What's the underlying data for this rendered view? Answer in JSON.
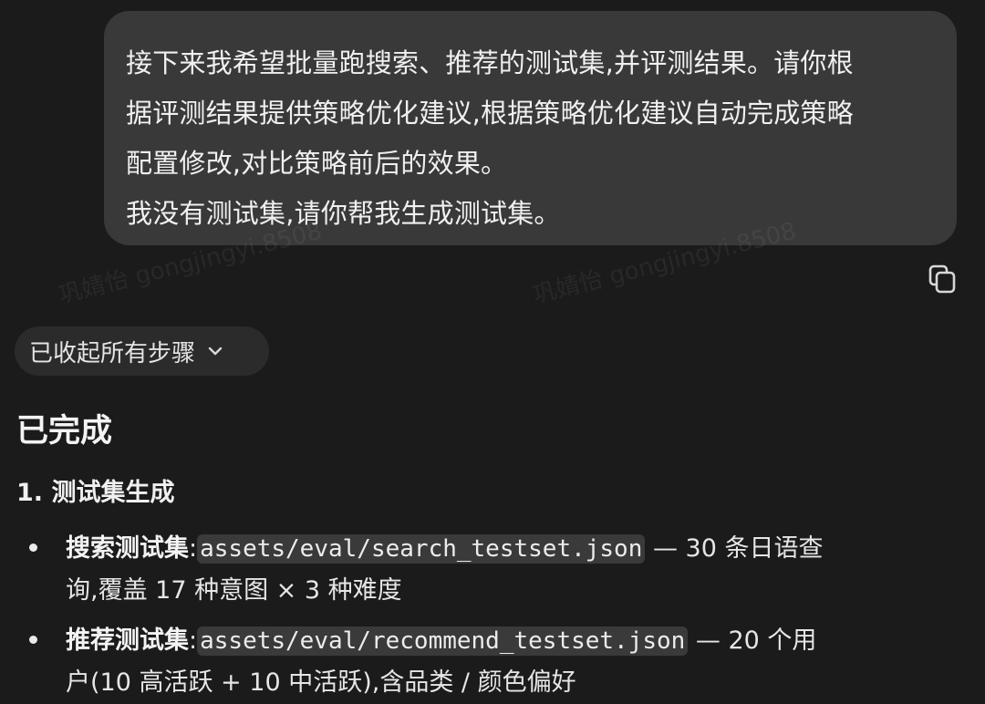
{
  "user_message": {
    "lines": [
      "接下来我希望批量跑搜索、推荐的测试集,并评测结果。请你根",
      "据评测结果提供策略优化建议,根据策略优化建议自动完成策略",
      "配置修改,对比策略前后的效果。",
      "我没有测试集,请你帮我生成测试集。"
    ]
  },
  "watermark": "巩婧怡 gongjingyi.8508",
  "icons": {
    "copy": "copy-icon",
    "chevron": "chevron-down-icon"
  },
  "steps_toggle": {
    "label": "已收起所有步骤"
  },
  "response": {
    "heading": "已完成",
    "section_title": "1. 测试集生成",
    "items": [
      {
        "label": "搜索测试集",
        "sep": ":",
        "path": "assets/eval/search_testset.json",
        "desc_line1": " — 30 条日语查",
        "desc_line2": "询,覆盖 17 种意图 × 3 种难度"
      },
      {
        "label": "推荐测试集",
        "sep": ":",
        "path": "assets/eval/recommend_testset.json",
        "desc_line1": " — 20 个用",
        "desc_line2": "户(10 高活跃 + 10 中活跃),含品类 / 颜色偏好"
      }
    ]
  }
}
